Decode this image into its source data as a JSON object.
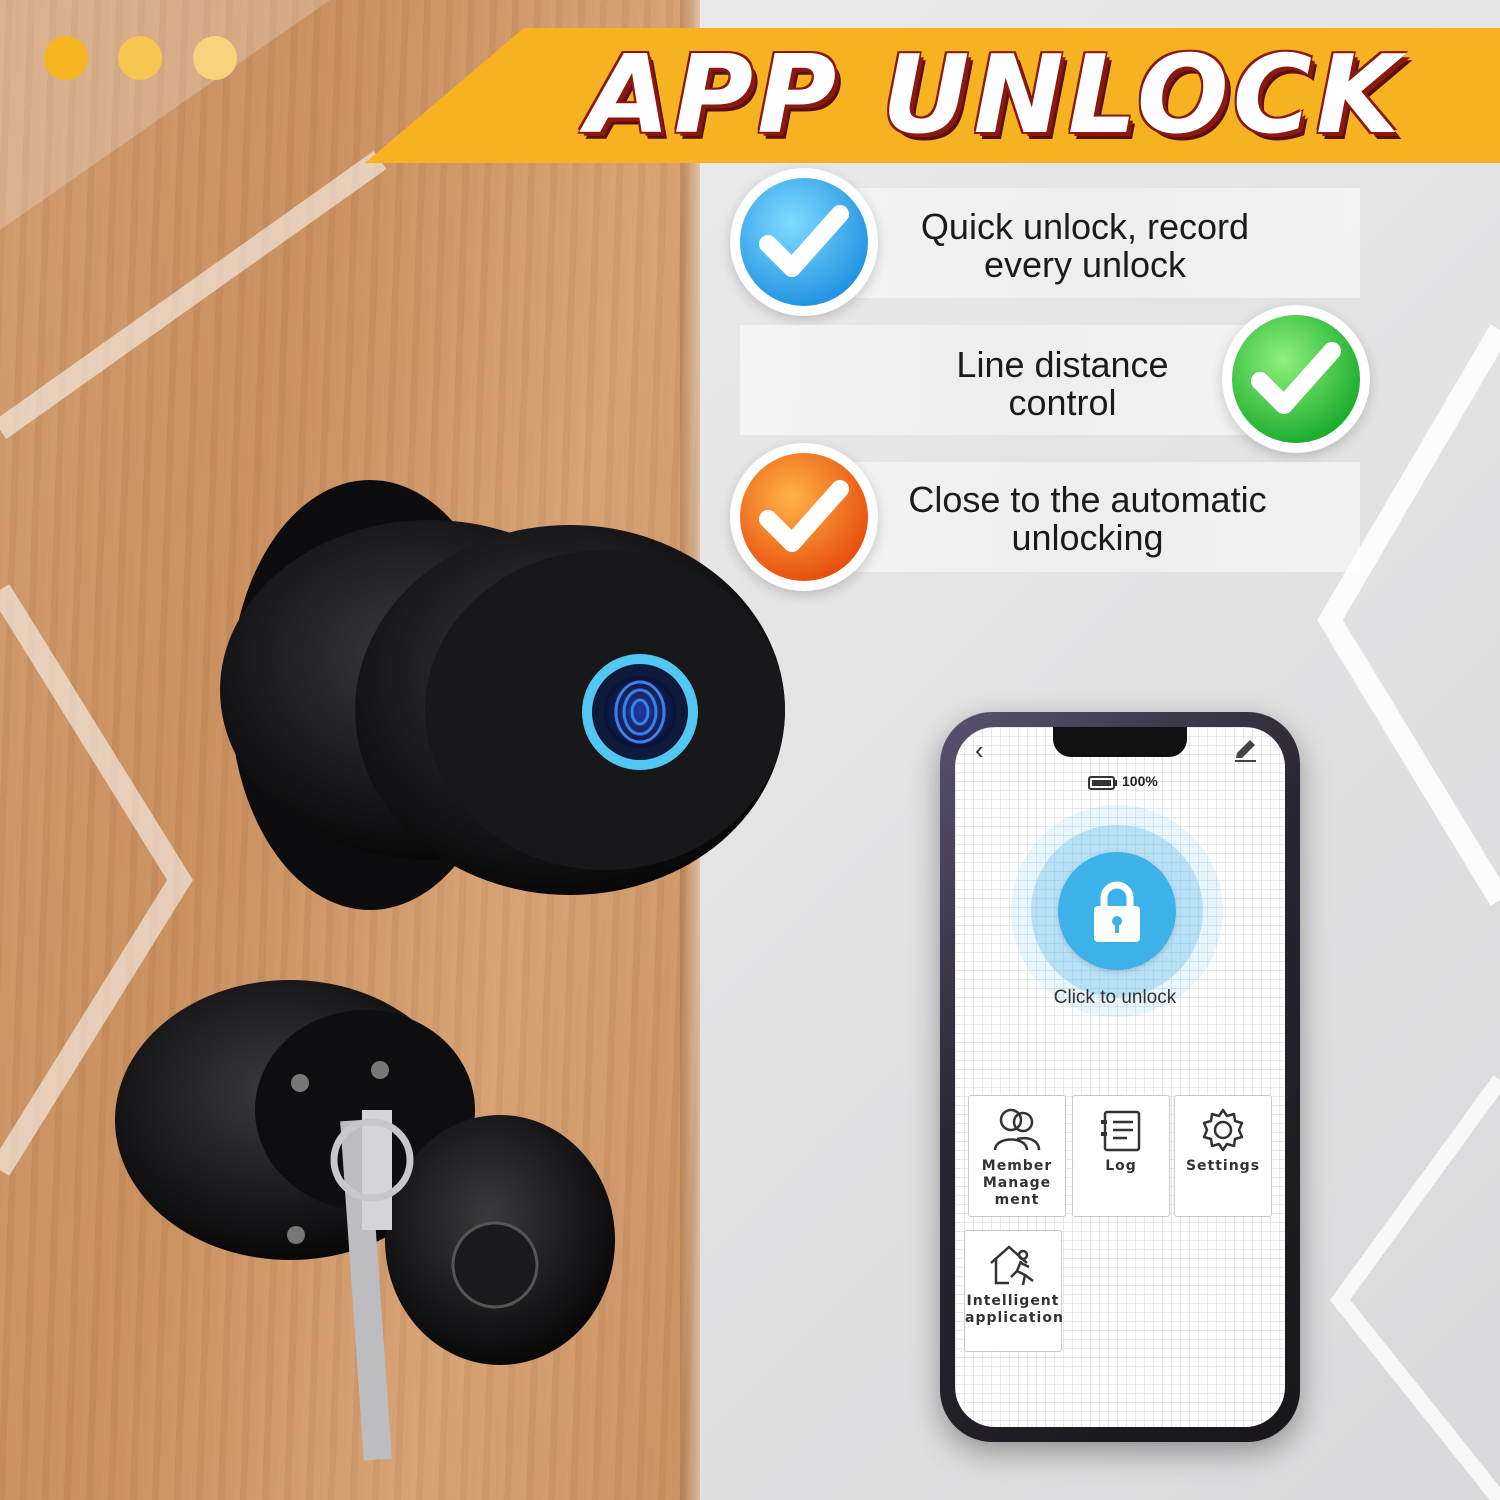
{
  "banner": {
    "title": "APP UNLOCK"
  },
  "decor_dots": [
    "#f5b51f",
    "#f7c550",
    "#f8d27c"
  ],
  "features": [
    {
      "text": "Quick unlock, record every unlock",
      "check_color": "#2fa8ef",
      "icon": "checkmark-icon"
    },
    {
      "text": "Line distance control",
      "check_color": "#29c23a",
      "icon": "checkmark-icon"
    },
    {
      "text": "Close to the automatic unlocking",
      "check_color": "#f07212",
      "icon": "checkmark-icon"
    }
  ],
  "phone": {
    "battery": "100%",
    "unlock_label": "Click to unlock",
    "accent": "#3db2e8",
    "tiles": [
      {
        "label": "Member Management",
        "icon": "members-icon"
      },
      {
        "label": "Log",
        "icon": "log-icon"
      },
      {
        "label": "Settings",
        "icon": "gear-icon"
      },
      {
        "label": "Intelligent application",
        "icon": "smart-home-icon"
      }
    ]
  }
}
